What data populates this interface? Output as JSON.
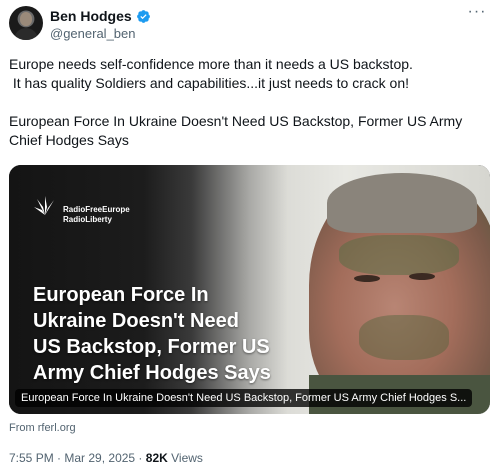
{
  "author": {
    "name": "Ben Hodges",
    "handle": "@general_ben",
    "verified_color": "#1d9bf0"
  },
  "tweet": {
    "line1": "Europe needs self-confidence more than it needs a US backstop.",
    "line2": " It has quality Soldiers and capabilities...it just needs to crack on!",
    "line3": "European Force In Ukraine Doesn't Need US Backstop, Former US Army",
    "line4": "Chief Hodges Says"
  },
  "card": {
    "logo_line1": "RadioFreeEurope",
    "logo_line2": "RadioLiberty",
    "headline": "European Force In\nUkraine Doesn't Need\nUS Backstop, Former US\nArmy Chief Hodges Says",
    "caption": "European Force In Ukraine Doesn't Need US Backstop, Former US Army Chief Hodges S..."
  },
  "source": "From rferl.org",
  "meta": {
    "time": "7:55 PM",
    "sep1": " · ",
    "date": "Mar 29, 2025",
    "sep2": " · ",
    "views_count": "82K",
    "views_label": " Views"
  },
  "icons": {
    "more": "more-icon",
    "verified": "verified-badge-icon",
    "logo": "rferl-logo-icon"
  }
}
